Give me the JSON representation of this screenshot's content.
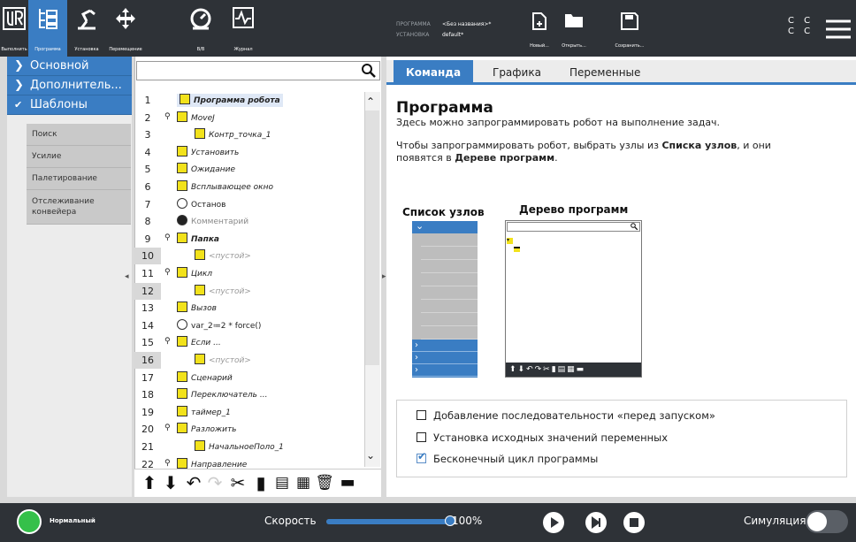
{
  "topbar": {
    "buttons": [
      {
        "label": "Выполнить"
      },
      {
        "label": "Программа"
      },
      {
        "label": "Установка"
      },
      {
        "label": "Перемещение"
      },
      {
        "label": "В/В"
      },
      {
        "label": "Журнал"
      }
    ],
    "program_key": "ПРОГРАММА",
    "program_value": "<Без названия>*",
    "install_key": "УСТАНОВКА",
    "install_value": "default*",
    "file_new": "Новый...",
    "file_open": "Открыть...",
    "file_save": "Сохранить...",
    "cc_top": "C C",
    "cc_bottom": "C C"
  },
  "leftnav": {
    "basic": "Основной",
    "advanced": "Дополнитель...",
    "templates": "Шаблоны",
    "template_items": [
      "Поиск",
      "Усилие",
      "Палетирование",
      "Отслеживание конвейера"
    ]
  },
  "tree": {
    "search_placeholder": "",
    "rows": [
      {
        "num": "1",
        "text": "Программа робота"
      },
      {
        "num": "2",
        "text": "MoveJ"
      },
      {
        "num": "3",
        "text": "Контр_точка_1"
      },
      {
        "num": "4",
        "text": "Установить"
      },
      {
        "num": "5",
        "text": "Ожидание"
      },
      {
        "num": "6",
        "text": "Всплывающее окно"
      },
      {
        "num": "7",
        "text": "Останов"
      },
      {
        "num": "8",
        "text": "Комментарий"
      },
      {
        "num": "9",
        "text": "Папка"
      },
      {
        "num": "10",
        "text": "<пустой>"
      },
      {
        "num": "11",
        "text": "Цикл"
      },
      {
        "num": "12",
        "text": "<пустой>"
      },
      {
        "num": "13",
        "text": "Вызов"
      },
      {
        "num": "14",
        "text": "var_2≔2 * force()"
      },
      {
        "num": "15",
        "text": "Если ..."
      },
      {
        "num": "16",
        "text": "<пустой>"
      },
      {
        "num": "17",
        "text": "Сценарий"
      },
      {
        "num": "18",
        "text": "Переключатель ..."
      },
      {
        "num": "19",
        "text": "таймер_1"
      },
      {
        "num": "20",
        "text": "Разложить"
      },
      {
        "num": "21",
        "text": "НачальноеПоло_1"
      },
      {
        "num": "22",
        "text": "Направление"
      }
    ]
  },
  "tabs": [
    "Команда",
    "Графика",
    "Переменные"
  ],
  "content": {
    "title": "Программа",
    "line1": "Здесь можно запрограммировать робот на выполнение задач.",
    "line2a": "Чтобы запрограммировать робот, выбрать узлы из ",
    "line2b": "Списка узлов",
    "line2c": ", и они",
    "line3a": "появятся в ",
    "line3b": "Дереве программ",
    "line3c": ".",
    "diag_list": "Список узлов",
    "diag_tree": "Дерево программ"
  },
  "options": [
    {
      "label": "Добавление последовательности «перед запуском»",
      "checked": false
    },
    {
      "label": "Установка исходных значений переменных",
      "checked": false
    },
    {
      "label": "Бесконечный цикл программы",
      "checked": true
    }
  ],
  "bottombar": {
    "status": "Нормальный",
    "speed_label": "Скорость",
    "speed_value": "100%",
    "speed_fraction": 1.0,
    "simulation_label": "Симуляция"
  },
  "colors": {
    "accent": "#3a7dc3",
    "node_yellow": "#f2e21b",
    "bar": "#2e3237",
    "status_green": "#35c04a"
  }
}
